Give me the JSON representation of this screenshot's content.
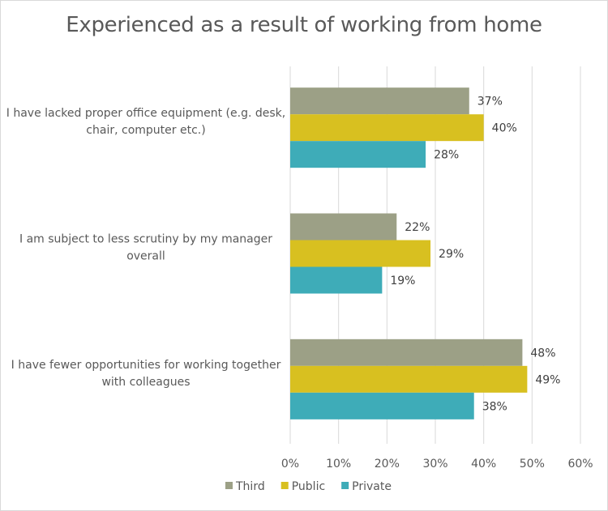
{
  "chart_data": {
    "type": "bar",
    "orientation": "horizontal",
    "title": "Experienced as a result of working from home",
    "xlabel": "",
    "ylabel": "",
    "categories": [
      [
        "I have lacked proper office equipment (e.g. desk,",
        "chair, computer etc.)"
      ],
      [
        "I am subject to less scrutiny by my manager",
        "overall"
      ],
      [
        "I have fewer opportunities for working together",
        "with colleagues"
      ]
    ],
    "series": [
      {
        "name": "Third",
        "color": "#9ca086",
        "values": [
          37,
          22,
          48
        ],
        "labels": [
          "37%",
          "22%",
          "48%"
        ]
      },
      {
        "name": "Public",
        "color": "#d8c020",
        "values": [
          40,
          29,
          49
        ],
        "labels": [
          "40%",
          "29%",
          "49%"
        ]
      },
      {
        "name": "Private",
        "color": "#3eacb8",
        "values": [
          28,
          19,
          38
        ],
        "labels": [
          "28%",
          "19%",
          "38%"
        ]
      }
    ],
    "xlim": [
      0,
      60
    ],
    "xticks": [
      0,
      10,
      20,
      30,
      40,
      50,
      60
    ],
    "xtick_labels": [
      "0%",
      "10%",
      "20%",
      "30%",
      "40%",
      "50%",
      "60%"
    ],
    "grid": true,
    "legend_position": "bottom"
  }
}
